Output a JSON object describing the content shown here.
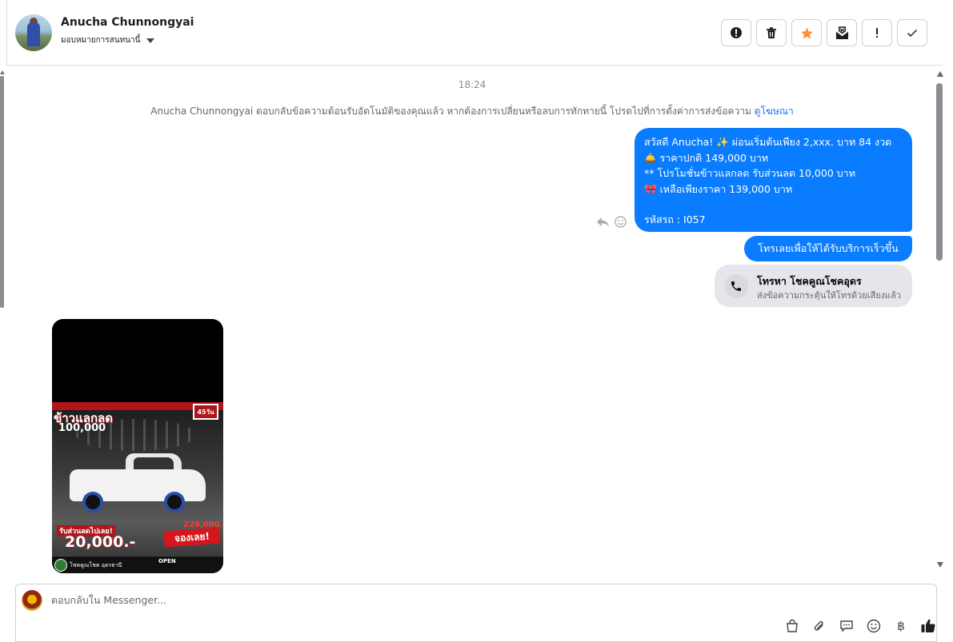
{
  "header": {
    "contact_name": "Anucha Chunnongyai",
    "assign_label": "มอบหมายการสนทนานี้"
  },
  "actions": [
    {
      "name": "report",
      "icon": "alert-circle-icon"
    },
    {
      "name": "delete",
      "icon": "trash-icon"
    },
    {
      "name": "star",
      "icon": "star-icon",
      "color": "#f7923b"
    },
    {
      "name": "mark-unread",
      "icon": "envelope-x-icon"
    },
    {
      "name": "follow-up",
      "icon": "exclamation-icon"
    },
    {
      "name": "done",
      "icon": "check-icon"
    }
  ],
  "conversation": {
    "time": "18:24",
    "system_note": "Anucha Chunnongyai ตอบกลับข้อความต้อนรับอัตโนมัติของคุณแล้ว หากต้องการเปลี่ยนหรือลบการทักทายนี้ โปรดไปที่การตั้งค่าการส่งข้อความ",
    "system_note_link": "ดูโฆษณา",
    "message1": {
      "line1": "สวัสดี Anucha! ✨  ผ่อนเริ่มต้นเพียง 2,xxx. บาท 84 งวด",
      "line2": "🛎️ ราคาปกติ 149,000 บาท",
      "line3": "** โปรโมชั่นข้าวแลกลด รับส่วนลด 10,000 บาท",
      "line4": "🎀  เหลือเพียงราคา 139,000 บาท",
      "line5": "รหัสรถ : I057"
    },
    "message2": "โทรเลยเพื่อให้ได้รับบริการเร็วขึ้น",
    "call_card": {
      "title": "โทรหา โชคคูณโชคอุดร",
      "subtitle": "ส่งข้อความกระตุ้นให้โทรด้วยเสียงแล้ว"
    },
    "ad": {
      "headline": "ข้าวแลกลด",
      "big_price": "100,000",
      "badge": "45วัน",
      "discount_label": "รับส่วนลดไปเลย!",
      "discount": "20,000.-",
      "small_price": "229,000.-",
      "book": "จองเลย!",
      "dealer": "โชคคูณโชค อุดรธานี",
      "open": "OPEN"
    }
  },
  "composer": {
    "placeholder": "ตอบกลับใน Messenger..."
  },
  "composer_tools": [
    "shopping-bag-icon",
    "paperclip-icon",
    "saved-reply-icon",
    "emoji-icon",
    "baht-icon",
    "thumbs-up-icon"
  ],
  "colors": {
    "accent": "#0a7cff",
    "star": "#f7923b",
    "link": "#1877f2"
  }
}
